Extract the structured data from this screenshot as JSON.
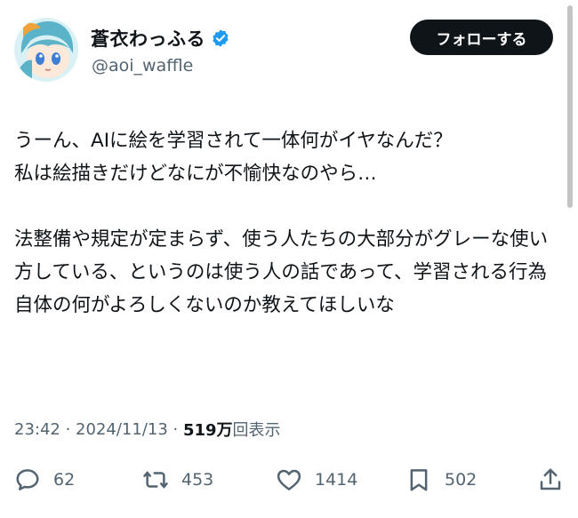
{
  "user": {
    "display_name": "蒼衣わっふる",
    "handle": "@aoi_waffle",
    "verified_icon": "verified-badge-icon",
    "avatar_colors": {
      "hair": "#5ab3c9",
      "hair_accent": "#f0a23a",
      "skin": "#fde9d9",
      "eyes": "#3b7fd6"
    }
  },
  "follow_button": {
    "label": "フォローする"
  },
  "tweet": {
    "text": "うーん、AIに絵を学習されて一体何がイヤなんだ？\n私は絵描きだけどなにが不愉快なのやら…\n\n法整備や規定が定まらず、使う人たちの大部分がグレーな使い方している、というのは使う人の話であって、学習される行為自体の何がよろしくないのか教えてほしいな"
  },
  "meta": {
    "time": "23:42",
    "separator": " · ",
    "date": "2024/11/13",
    "views_count": "519万",
    "views_label": "回表示"
  },
  "actions": {
    "reply": {
      "icon": "reply-icon",
      "count": "62"
    },
    "repost": {
      "icon": "repost-icon",
      "count": "453"
    },
    "like": {
      "icon": "heart-icon",
      "count": "1414"
    },
    "bookmark": {
      "icon": "bookmark-icon",
      "count": "502"
    },
    "share": {
      "icon": "share-icon"
    }
  },
  "colors": {
    "text": "#0f1419",
    "secondary": "#536471",
    "verified": "#1d9bf0",
    "follow_bg": "#0f1419"
  }
}
